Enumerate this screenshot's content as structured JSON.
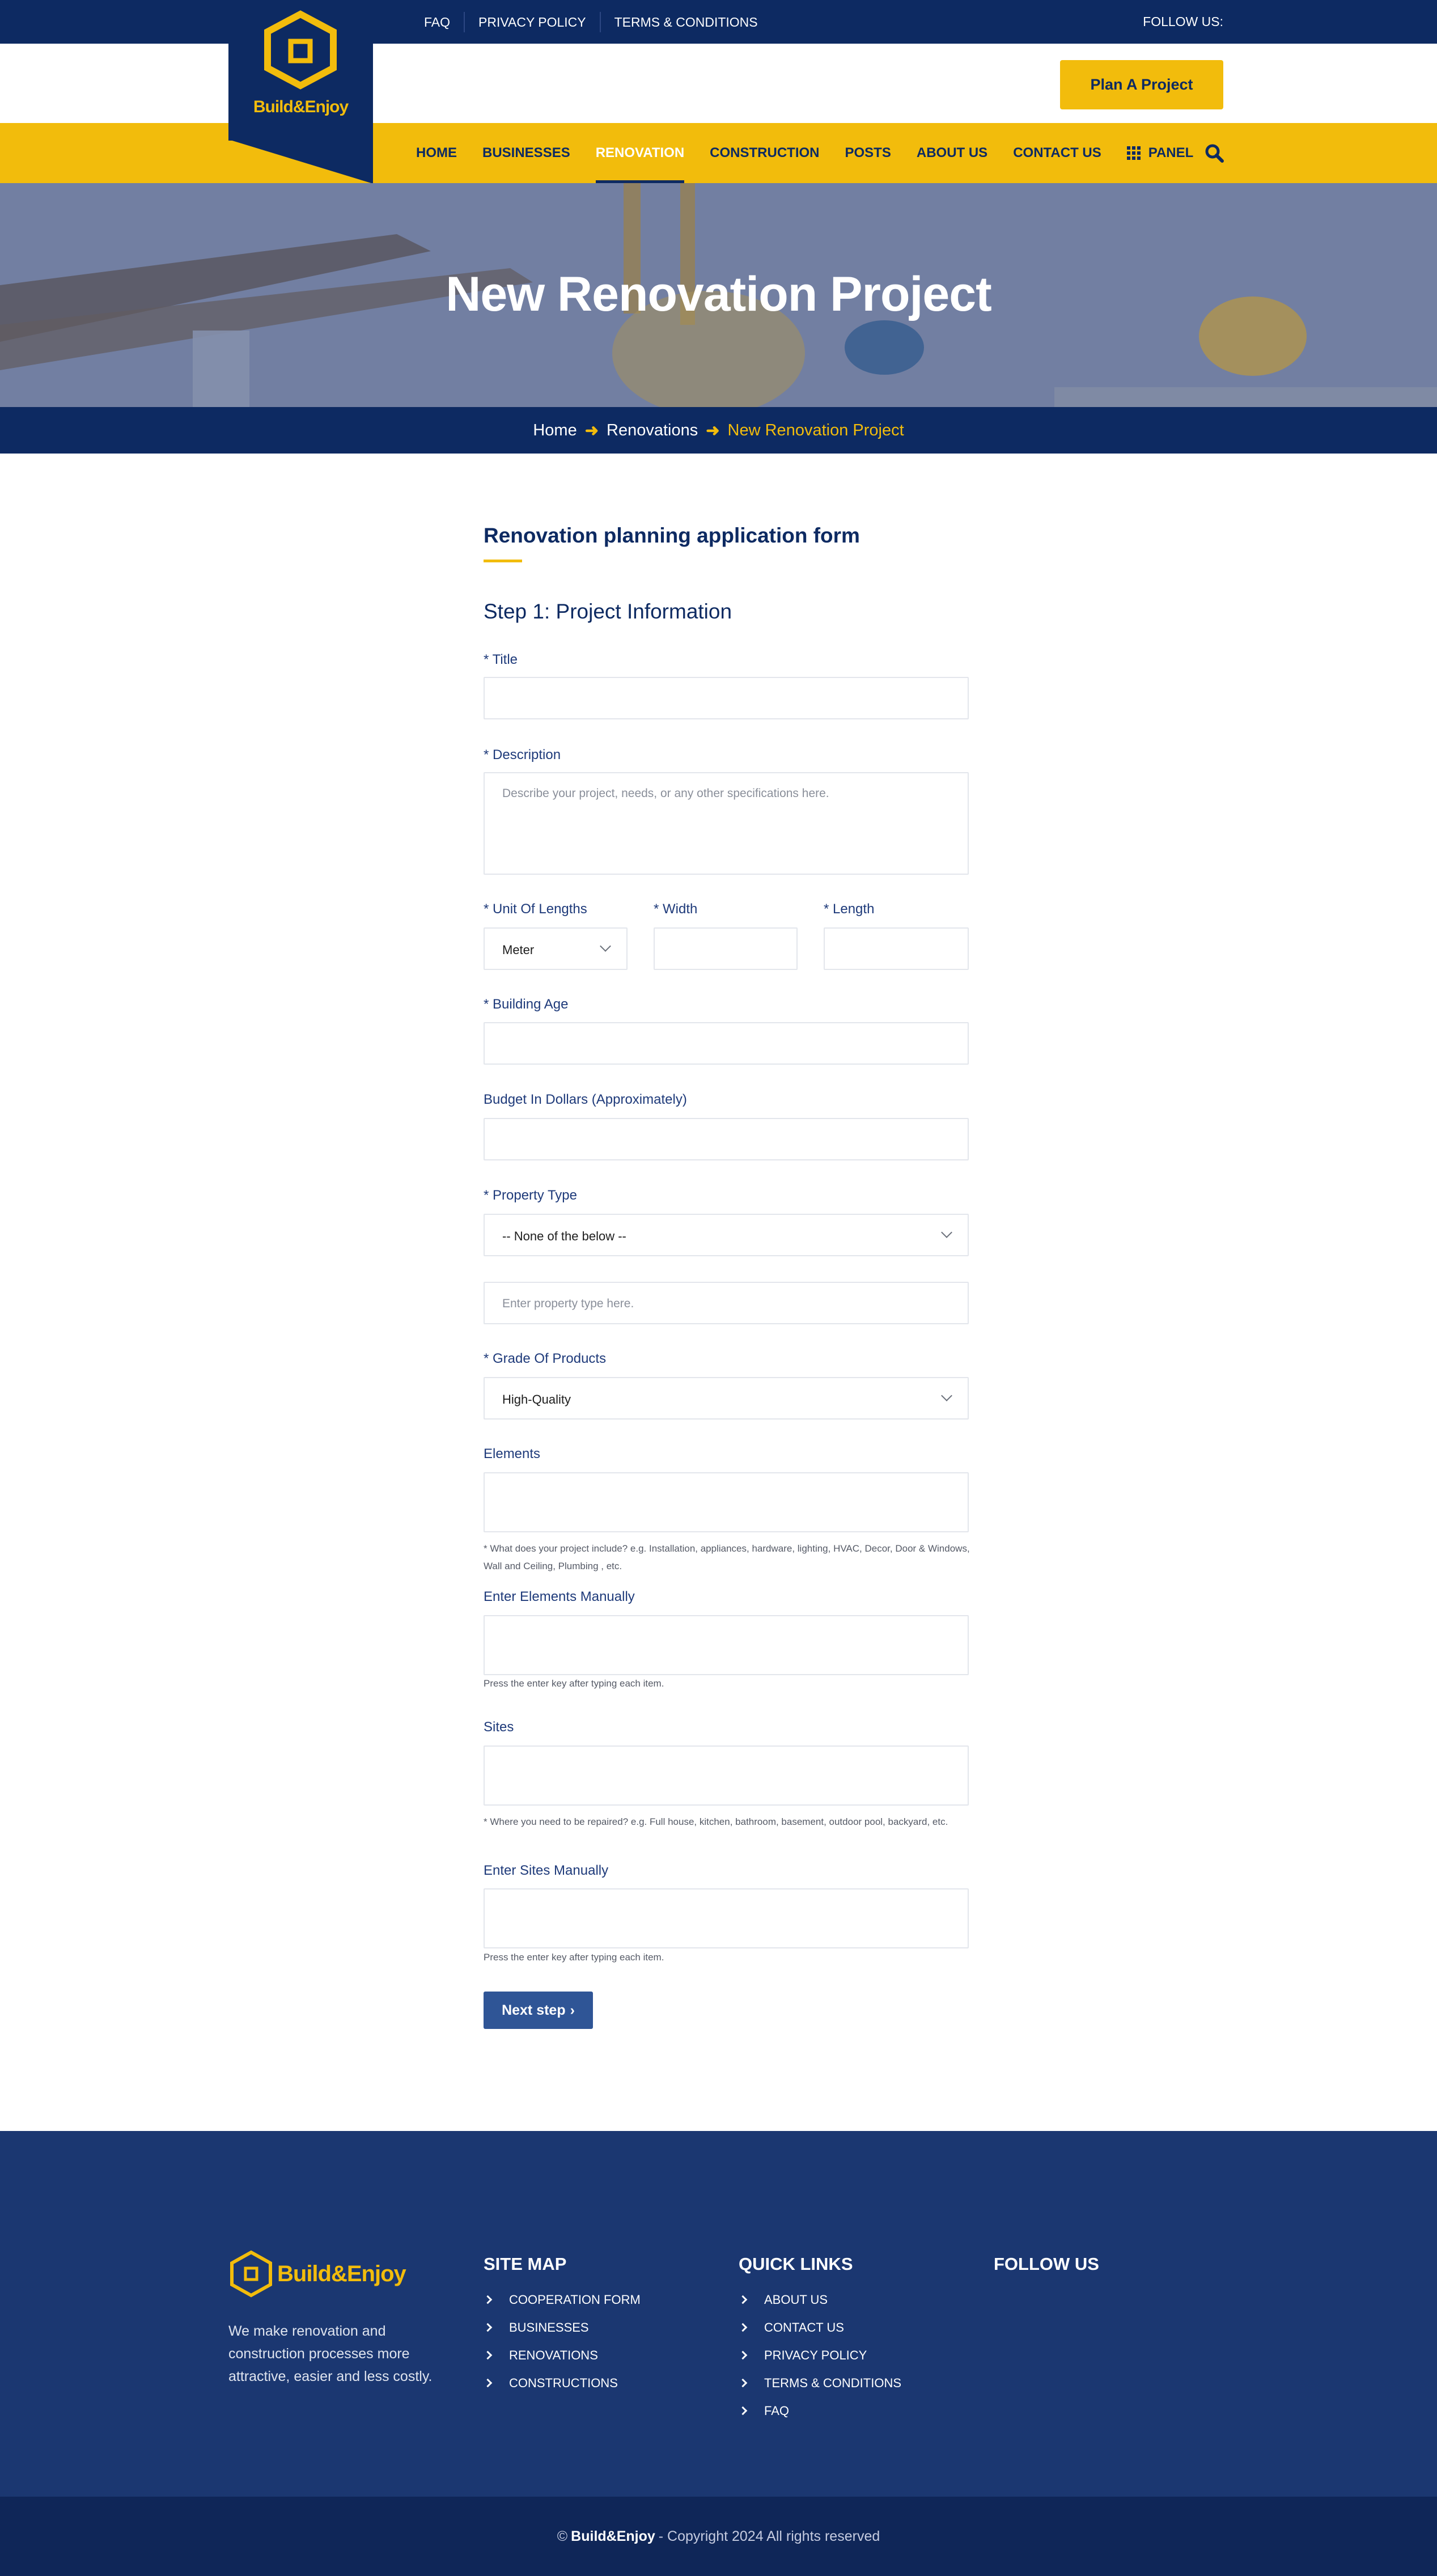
{
  "topbar": {
    "links": [
      "FAQ",
      "PRIVACY POLICY",
      "TERMS & CONDITIONS"
    ],
    "follow_label": "FOLLOW US:"
  },
  "brand": {
    "name": "Build&Enjoy"
  },
  "header": {
    "cta_label": "Plan A Project"
  },
  "nav": {
    "items": [
      "HOME",
      "BUSINESSES",
      "RENOVATION",
      "CONSTRUCTION",
      "POSTS",
      "ABOUT US",
      "CONTACT US"
    ],
    "active": "RENOVATION",
    "panel_label": "PANEL"
  },
  "hero": {
    "title": "New Renovation Project"
  },
  "breadcrumb": {
    "home": "Home",
    "section": "Renovations",
    "current": "New Renovation Project"
  },
  "form": {
    "heading": "Renovation planning application form",
    "step_title": "Step 1: Project Information",
    "title_label": "Title",
    "description_label": "Description",
    "description_placeholder": "Describe your project, needs, or any other specifications here.",
    "unit_label": "Unit Of Lengths",
    "unit_value": "Meter",
    "width_label": "Width",
    "length_label": "Length",
    "building_age_label": "Building Age",
    "budget_label": "Budget In Dollars (Approximately)",
    "property_type_label": "Property Type",
    "property_type_value": "-- None of the below --",
    "property_type_placeholder": "Enter property type here.",
    "grade_label": "Grade Of Products",
    "grade_value": "High-Quality",
    "elements_label": "Elements",
    "elements_hint": "* What does your project include? e.g. Installation, appliances, hardware, lighting, HVAC, Decor, Door & Windows, Wall and Ceiling, Plumbing , etc.",
    "elements_manual_label": "Enter Elements Manually",
    "elements_manual_hint": "Press the enter key after typing each item.",
    "sites_label": "Sites",
    "sites_hint": "* Where you need to be repaired? e.g. Full house, kitchen, bathroom, basement, outdoor pool, backyard, etc.",
    "sites_manual_label": "Enter Sites Manually",
    "sites_manual_hint": "Press the enter key after typing each item.",
    "required_mark": "*",
    "next_label": "Next step"
  },
  "footer": {
    "about": "We make renovation and construction processes more attractive, easier and less costly.",
    "sitemap_title": "SITE MAP",
    "sitemap": [
      "COOPERATION FORM",
      "BUSINESSES",
      "RENOVATIONS",
      "CONSTRUCTIONS"
    ],
    "quicklinks_title": "QUICK LINKS",
    "quicklinks": [
      "ABOUT US",
      "CONTACT US",
      "PRIVACY POLICY",
      "TERMS & CONDITIONS",
      "FAQ"
    ],
    "follow_title": "FOLLOW US",
    "copyright_prefix": "©",
    "copyright_brand": "Build&Enjoy",
    "copyright_text": "- Copyright 2024 All rights reserved"
  },
  "colors": {
    "navy": "#0d2a62",
    "yellow": "#f2bc0c",
    "button_blue": "#2f5596",
    "footer_blue": "#1b3771"
  },
  "icons": [
    "hexagon-logo-icon",
    "panel-grid-icon",
    "search-icon",
    "chevron-down-icon",
    "chevron-right-icon",
    "arrow-right-icon"
  ]
}
